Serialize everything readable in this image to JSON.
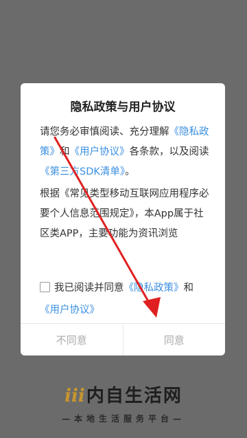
{
  "dialog": {
    "title": "隐私政策与用户协议",
    "intro_1": "请您务必审慎阅读、充分理解",
    "privacy_link": "《隐私政策》",
    "intro_and": "和",
    "user_link": "《用户协议》",
    "intro_2": "各条款，以及阅读",
    "sdk_link": "《第三方SDK清单》",
    "intro_end": "。",
    "para_2": "根据《常见类型移动互联网应用程序必要个人信息范围规定》，本App属于社区类APP，主要功能为资讯浏览",
    "agree_prefix": "我已阅读并同意",
    "agree_privacy": "《隐私政策》",
    "agree_and": "和",
    "agree_user": "《用户协议》",
    "disagree_button": "不同意",
    "agree_button": "同意"
  },
  "brand": {
    "mark": "iii",
    "name": "内自生活网",
    "slogan": "—本地生活服务平台—"
  },
  "colors": {
    "link": "#3b8fe0",
    "annotation_arrow": "#e02020",
    "overlay": "#6b6b6b"
  }
}
